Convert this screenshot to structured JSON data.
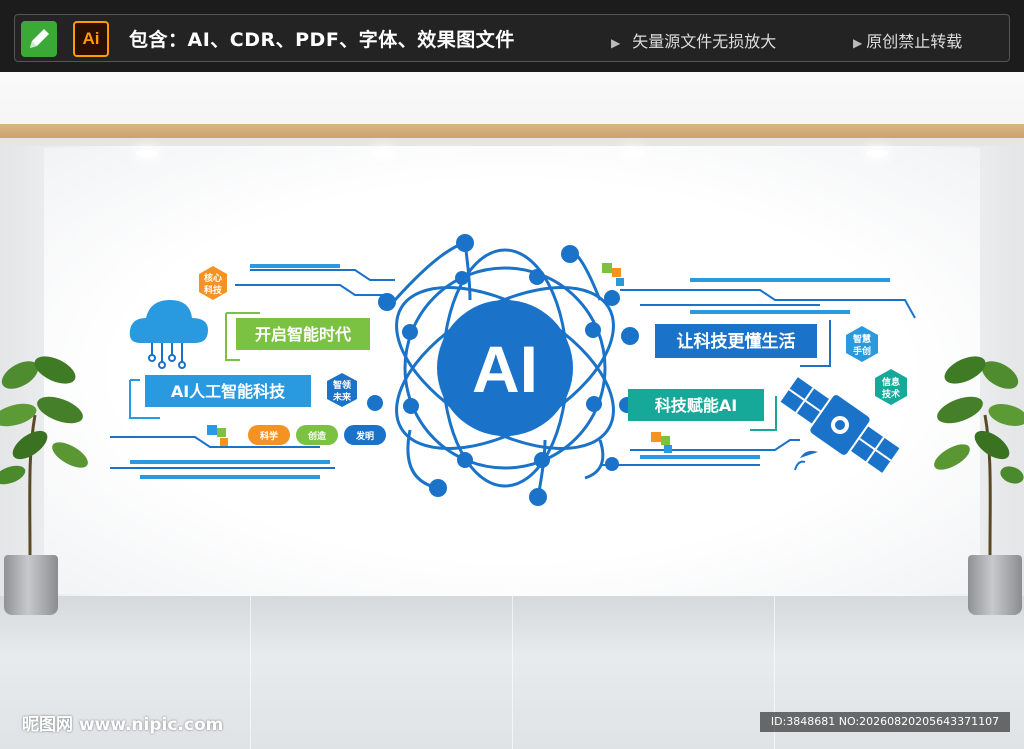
{
  "banner": {
    "title": "包含：AI、CDR、PDF、字体、效果图文件",
    "ai_tile_label": "Ai",
    "note_vector": "矢量源文件无损放大",
    "note_original": "原创禁止转载"
  },
  "artwork": {
    "center_label": "AI",
    "label_open_era": "开启智能时代",
    "label_ai_tech": "AI人工智能科技",
    "label_better_life": "让科技更懂生活",
    "label_empower": "科技赋能AI",
    "badge_core_line1": "核心",
    "badge_core_line2": "科技",
    "badge_lead_line1": "智领",
    "badge_lead_line2": "未来",
    "badge_wisdom_line1": "智慧",
    "badge_wisdom_line2": "手创",
    "badge_info_line1": "信息",
    "badge_info_line2": "技术",
    "pill_science": "科学",
    "pill_create": "创造",
    "pill_invent": "发明"
  },
  "colors": {
    "blue": "#1a73c8",
    "light_blue": "#2a9ae0",
    "green": "#7cc242",
    "teal": "#16a99a",
    "orange": "#f39323"
  },
  "watermark": {
    "site": "昵图网 www.nipic.com",
    "id_text": "ID:3848681 NO:20260820205643371107"
  }
}
